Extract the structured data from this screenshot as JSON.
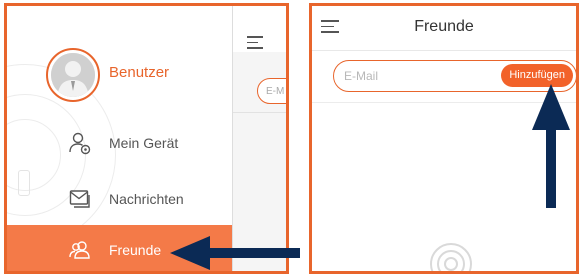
{
  "left": {
    "user_name": "Benutzer",
    "menu": [
      {
        "label": "Mein Gerät",
        "icon": "user-device-icon"
      },
      {
        "label": "Nachrichten",
        "icon": "message-icon"
      },
      {
        "label": "Freunde",
        "icon": "friends-icon",
        "selected": true
      }
    ],
    "peek_placeholder": "E-M"
  },
  "right": {
    "title": "Freunde",
    "search_placeholder": "E-Mail",
    "add_button": "Hinzufügen"
  },
  "colors": {
    "accent": "#e8652c",
    "selected_bg": "#f47a48",
    "arrow": "#0b2a55"
  }
}
